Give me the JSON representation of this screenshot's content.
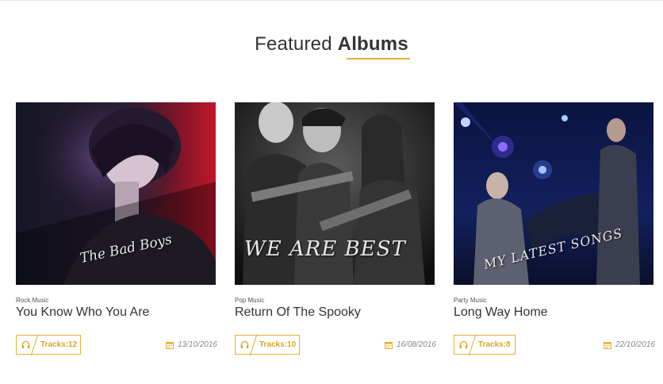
{
  "section": {
    "title_light": "Featured",
    "title_bold": "Albums"
  },
  "colors": {
    "accent": "#e2b23a",
    "text_dark": "#333333",
    "text_muted": "#888888"
  },
  "albums": [
    {
      "cover_text": "The Bad Boys",
      "genre": "Rock Music",
      "title": "You Know Who You Are",
      "tracks": "Tracks:12",
      "date": "13/10/2016",
      "icon": "headphones-icon",
      "date_icon": "calendar-icon"
    },
    {
      "cover_text": "WE ARE BEST",
      "genre": "Pop Music",
      "title": "Return Of The Spooky",
      "tracks": "Tracks:10",
      "date": "16/08/2016",
      "icon": "headphones-icon",
      "date_icon": "calendar-icon"
    },
    {
      "cover_text": "MY LATEST SONGS",
      "genre": "Party Music",
      "title": "Long Way Home",
      "tracks": "Tracks:8",
      "date": "22/10/2016",
      "icon": "headphones-icon",
      "date_icon": "calendar-icon"
    }
  ]
}
